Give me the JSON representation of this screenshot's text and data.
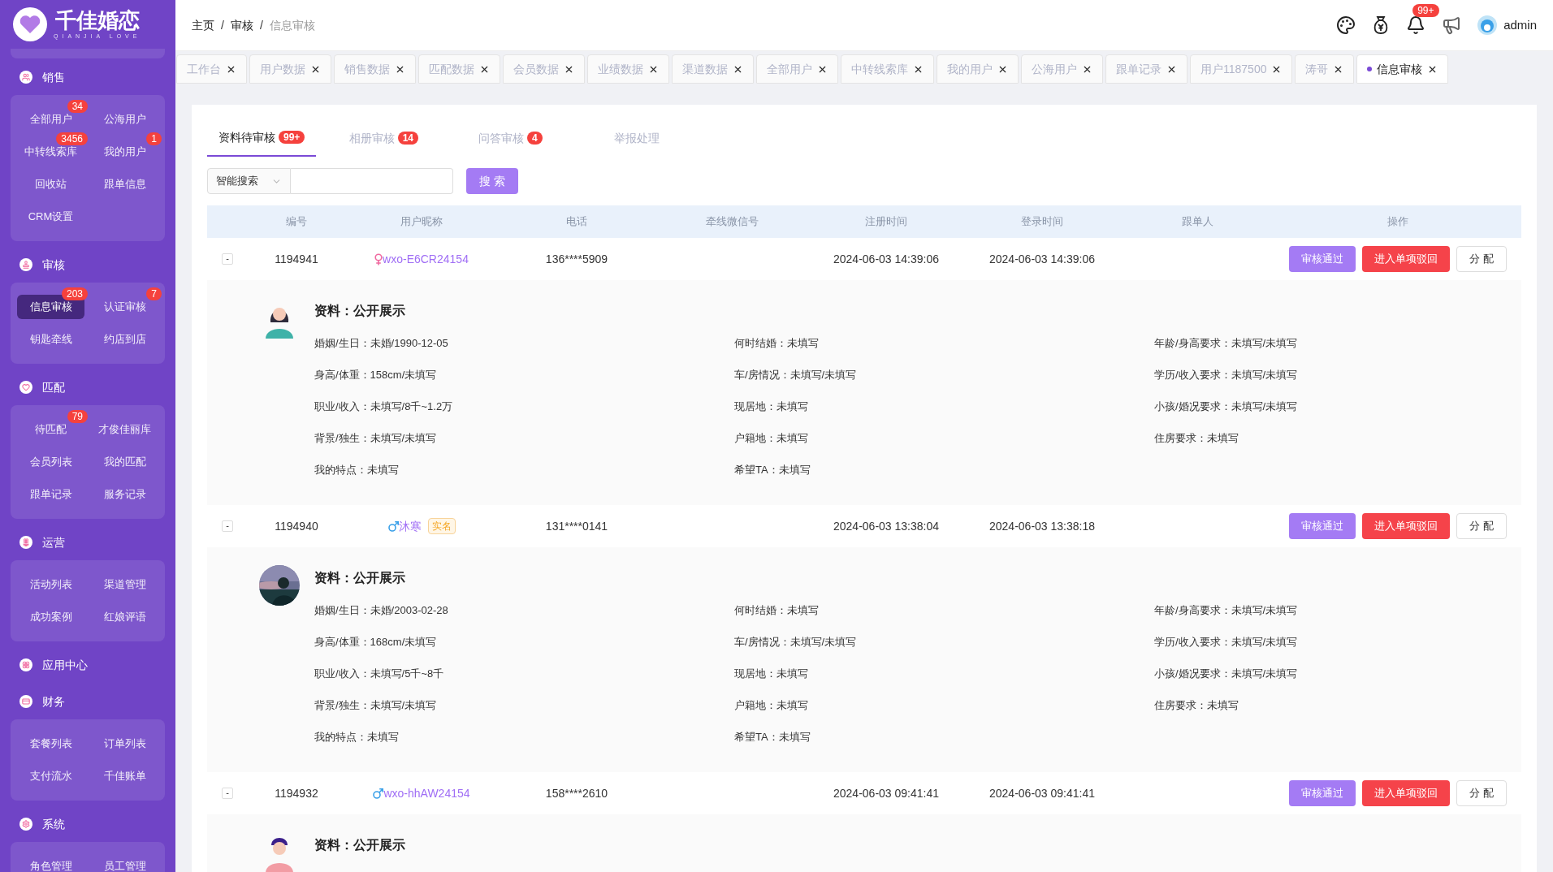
{
  "logo": {
    "title": "千佳婚恋",
    "subtitle": "QIANJIA LOVE"
  },
  "sidebar": {
    "sections": [
      {
        "title": "销售",
        "items": [
          {
            "label": "全部用户",
            "badge": "34",
            "selected": false
          },
          {
            "label": "公海用户",
            "selected": false
          },
          {
            "label": "中转线索库",
            "badge": "3456",
            "selected": false
          },
          {
            "label": "我的用户",
            "badge": "1",
            "selected": false
          },
          {
            "label": "回收站",
            "selected": false
          },
          {
            "label": "跟单信息",
            "selected": false
          },
          {
            "label": "CRM设置",
            "selected": false
          }
        ]
      },
      {
        "title": "审核",
        "items": [
          {
            "label": "信息审核",
            "badge": "203",
            "selected": true
          },
          {
            "label": "认证审核",
            "badge": "7",
            "selected": false
          },
          {
            "label": "钥匙牵线",
            "selected": false
          },
          {
            "label": "约店到店",
            "selected": false
          }
        ]
      },
      {
        "title": "匹配",
        "items": [
          {
            "label": "待匹配",
            "badge": "79",
            "selected": false
          },
          {
            "label": "才俊佳丽库",
            "selected": false
          },
          {
            "label": "会员列表",
            "selected": false
          },
          {
            "label": "我的匹配",
            "selected": false
          },
          {
            "label": "跟单记录",
            "selected": false
          },
          {
            "label": "服务记录",
            "selected": false
          }
        ]
      },
      {
        "title": "运营",
        "items": [
          {
            "label": "活动列表",
            "selected": false
          },
          {
            "label": "渠道管理",
            "selected": false
          },
          {
            "label": "成功案例",
            "selected": false
          },
          {
            "label": "红娘评语",
            "selected": false
          }
        ]
      },
      {
        "title": "应用中心"
      },
      {
        "title": "财务",
        "items": [
          {
            "label": "套餐列表",
            "selected": false
          },
          {
            "label": "订单列表",
            "selected": false
          },
          {
            "label": "支付流水",
            "selected": false
          },
          {
            "label": "千佳账单",
            "selected": false
          }
        ]
      },
      {
        "title": "系统",
        "items": [
          {
            "label": "角色管理",
            "selected": false
          },
          {
            "label": "员工管理",
            "selected": false
          }
        ]
      }
    ]
  },
  "breadcrumb": [
    {
      "kind": "link",
      "text": "主页"
    },
    {
      "kind": "separator",
      "text": "/"
    },
    {
      "kind": "link",
      "text": "审核"
    },
    {
      "kind": "separator",
      "text": "/"
    },
    {
      "kind": "current",
      "text": "信息审核"
    }
  ],
  "header": {
    "notifications": "99+",
    "user": "admin"
  },
  "tabs": [
    {
      "label": "工作台",
      "selected": false
    },
    {
      "label": "用户数据",
      "selected": false
    },
    {
      "label": "销售数据",
      "selected": false
    },
    {
      "label": "匹配数据",
      "selected": false
    },
    {
      "label": "会员数据",
      "selected": false
    },
    {
      "label": "业绩数据",
      "selected": false
    },
    {
      "label": "渠道数据",
      "selected": false
    },
    {
      "label": "全部用户",
      "selected": false
    },
    {
      "label": "中转线索库",
      "selected": false
    },
    {
      "label": "我的用户",
      "selected": false
    },
    {
      "label": "公海用户",
      "selected": false
    },
    {
      "label": "跟单记录",
      "selected": false
    },
    {
      "label": "用户1187500",
      "selected": false
    },
    {
      "label": "涛哥",
      "selected": false
    },
    {
      "label": "信息审核",
      "selected": true
    }
  ],
  "subtabs": [
    {
      "label": "资料待审核",
      "badge": "99+",
      "selected": true
    },
    {
      "label": "相册审核",
      "badge": "14",
      "selected": false
    },
    {
      "label": "问答审核",
      "badge": "4",
      "selected": false
    },
    {
      "label": "举报处理",
      "selected": false
    }
  ],
  "search": {
    "select": "智能搜索",
    "button": "搜 索"
  },
  "table": {
    "columns": [
      "编号",
      "用户昵称",
      "电话",
      "牵线微信号",
      "注册时间",
      "登录时间",
      "跟单人",
      "操作"
    ],
    "rows": [
      {
        "toggle": "-",
        "id": "1194941",
        "color": "#f06aa0",
        "kind": "female",
        "nickname": "wxo-E6CR24154",
        "phone": "136****5909",
        "registered": "2024-06-03 14:39:06",
        "login": "2024-06-03 14:39:06",
        "actions": [
          "审核通过",
          "进入单项驳回",
          "分 配"
        ],
        "expanded": true,
        "detail": {
          "kind": "illustration",
          "title": "资料：公开展示",
          "fields": [
            "婚姻/生日：未婚/1990-12-05",
            "何时结婚：未填写",
            "年龄/身高要求：未填写/未填写",
            "身高/体重：158cm/未填写",
            "车/房情况：未填写/未填写",
            "学历/收入要求：未填写/未填写",
            "职业/收入：未填写/8千~1.2万",
            "现居地：未填写",
            "小孩/婚况要求：未填写/未填写",
            "背景/独生：未填写/未填写",
            "户籍地：未填写",
            "住房要求：未填写",
            "我的特点：未填写",
            "希望TA：未填写"
          ]
        }
      },
      {
        "toggle": "-",
        "id": "1194940",
        "color": "#3aa0e8",
        "kind": "male",
        "nickname": "沐寒",
        "tag": "实名",
        "phone": "131****0141",
        "registered": "2024-06-03 13:38:04",
        "login": "2024-06-03 13:38:18",
        "actions": [
          "审核通过",
          "进入单项驳回",
          "分 配"
        ],
        "expanded": true,
        "detail": {
          "kind": "picture",
          "title": "资料：公开展示",
          "fields": [
            "婚姻/生日：未婚/2003-02-28",
            "何时结婚：未填写",
            "年龄/身高要求：未填写/未填写",
            "身高/体重：168cm/未填写",
            "车/房情况：未填写/未填写",
            "学历/收入要求：未填写/未填写",
            "职业/收入：未填写/5千~8千",
            "现居地：未填写",
            "小孩/婚况要求：未填写/未填写",
            "背景/独生：未填写/未填写",
            "户籍地：未填写",
            "住房要求：未填写",
            "我的特点：未填写",
            "希望TA：未填写"
          ]
        }
      },
      {
        "toggle": "-",
        "id": "1194932",
        "color": "#3aa0e8",
        "kind": "male",
        "nickname": "wxo-hhAW24154",
        "phone": "158****2610",
        "registered": "2024-06-03 09:41:41",
        "login": "2024-06-03 09:41:41",
        "actions": [
          "审核通过",
          "进入单项驳回",
          "分 配"
        ],
        "expanded": true,
        "detail": {
          "kind": "illustration",
          "title": "资料：公开展示"
        }
      }
    ]
  }
}
